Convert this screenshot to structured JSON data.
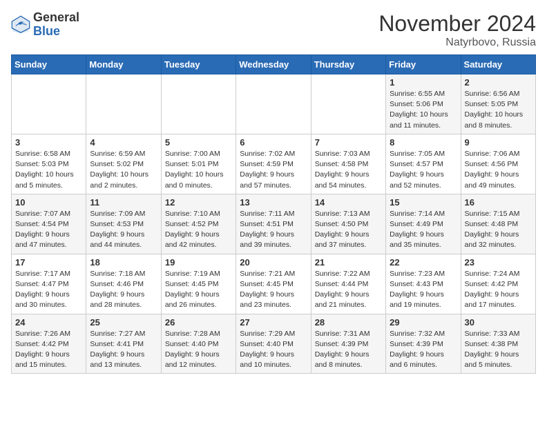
{
  "header": {
    "logo_general": "General",
    "logo_blue": "Blue",
    "month_title": "November 2024",
    "location": "Natyrbovo, Russia"
  },
  "days_of_week": [
    "Sunday",
    "Monday",
    "Tuesday",
    "Wednesday",
    "Thursday",
    "Friday",
    "Saturday"
  ],
  "weeks": [
    [
      {
        "day": "",
        "info": ""
      },
      {
        "day": "",
        "info": ""
      },
      {
        "day": "",
        "info": ""
      },
      {
        "day": "",
        "info": ""
      },
      {
        "day": "",
        "info": ""
      },
      {
        "day": "1",
        "info": "Sunrise: 6:55 AM\nSunset: 5:06 PM\nDaylight: 10 hours and 11 minutes."
      },
      {
        "day": "2",
        "info": "Sunrise: 6:56 AM\nSunset: 5:05 PM\nDaylight: 10 hours and 8 minutes."
      }
    ],
    [
      {
        "day": "3",
        "info": "Sunrise: 6:58 AM\nSunset: 5:03 PM\nDaylight: 10 hours and 5 minutes."
      },
      {
        "day": "4",
        "info": "Sunrise: 6:59 AM\nSunset: 5:02 PM\nDaylight: 10 hours and 2 minutes."
      },
      {
        "day": "5",
        "info": "Sunrise: 7:00 AM\nSunset: 5:01 PM\nDaylight: 10 hours and 0 minutes."
      },
      {
        "day": "6",
        "info": "Sunrise: 7:02 AM\nSunset: 4:59 PM\nDaylight: 9 hours and 57 minutes."
      },
      {
        "day": "7",
        "info": "Sunrise: 7:03 AM\nSunset: 4:58 PM\nDaylight: 9 hours and 54 minutes."
      },
      {
        "day": "8",
        "info": "Sunrise: 7:05 AM\nSunset: 4:57 PM\nDaylight: 9 hours and 52 minutes."
      },
      {
        "day": "9",
        "info": "Sunrise: 7:06 AM\nSunset: 4:56 PM\nDaylight: 9 hours and 49 minutes."
      }
    ],
    [
      {
        "day": "10",
        "info": "Sunrise: 7:07 AM\nSunset: 4:54 PM\nDaylight: 9 hours and 47 minutes."
      },
      {
        "day": "11",
        "info": "Sunrise: 7:09 AM\nSunset: 4:53 PM\nDaylight: 9 hours and 44 minutes."
      },
      {
        "day": "12",
        "info": "Sunrise: 7:10 AM\nSunset: 4:52 PM\nDaylight: 9 hours and 42 minutes."
      },
      {
        "day": "13",
        "info": "Sunrise: 7:11 AM\nSunset: 4:51 PM\nDaylight: 9 hours and 39 minutes."
      },
      {
        "day": "14",
        "info": "Sunrise: 7:13 AM\nSunset: 4:50 PM\nDaylight: 9 hours and 37 minutes."
      },
      {
        "day": "15",
        "info": "Sunrise: 7:14 AM\nSunset: 4:49 PM\nDaylight: 9 hours and 35 minutes."
      },
      {
        "day": "16",
        "info": "Sunrise: 7:15 AM\nSunset: 4:48 PM\nDaylight: 9 hours and 32 minutes."
      }
    ],
    [
      {
        "day": "17",
        "info": "Sunrise: 7:17 AM\nSunset: 4:47 PM\nDaylight: 9 hours and 30 minutes."
      },
      {
        "day": "18",
        "info": "Sunrise: 7:18 AM\nSunset: 4:46 PM\nDaylight: 9 hours and 28 minutes."
      },
      {
        "day": "19",
        "info": "Sunrise: 7:19 AM\nSunset: 4:45 PM\nDaylight: 9 hours and 26 minutes."
      },
      {
        "day": "20",
        "info": "Sunrise: 7:21 AM\nSunset: 4:45 PM\nDaylight: 9 hours and 23 minutes."
      },
      {
        "day": "21",
        "info": "Sunrise: 7:22 AM\nSunset: 4:44 PM\nDaylight: 9 hours and 21 minutes."
      },
      {
        "day": "22",
        "info": "Sunrise: 7:23 AM\nSunset: 4:43 PM\nDaylight: 9 hours and 19 minutes."
      },
      {
        "day": "23",
        "info": "Sunrise: 7:24 AM\nSunset: 4:42 PM\nDaylight: 9 hours and 17 minutes."
      }
    ],
    [
      {
        "day": "24",
        "info": "Sunrise: 7:26 AM\nSunset: 4:42 PM\nDaylight: 9 hours and 15 minutes."
      },
      {
        "day": "25",
        "info": "Sunrise: 7:27 AM\nSunset: 4:41 PM\nDaylight: 9 hours and 13 minutes."
      },
      {
        "day": "26",
        "info": "Sunrise: 7:28 AM\nSunset: 4:40 PM\nDaylight: 9 hours and 12 minutes."
      },
      {
        "day": "27",
        "info": "Sunrise: 7:29 AM\nSunset: 4:40 PM\nDaylight: 9 hours and 10 minutes."
      },
      {
        "day": "28",
        "info": "Sunrise: 7:31 AM\nSunset: 4:39 PM\nDaylight: 9 hours and 8 minutes."
      },
      {
        "day": "29",
        "info": "Sunrise: 7:32 AM\nSunset: 4:39 PM\nDaylight: 9 hours and 6 minutes."
      },
      {
        "day": "30",
        "info": "Sunrise: 7:33 AM\nSunset: 4:38 PM\nDaylight: 9 hours and 5 minutes."
      }
    ]
  ]
}
